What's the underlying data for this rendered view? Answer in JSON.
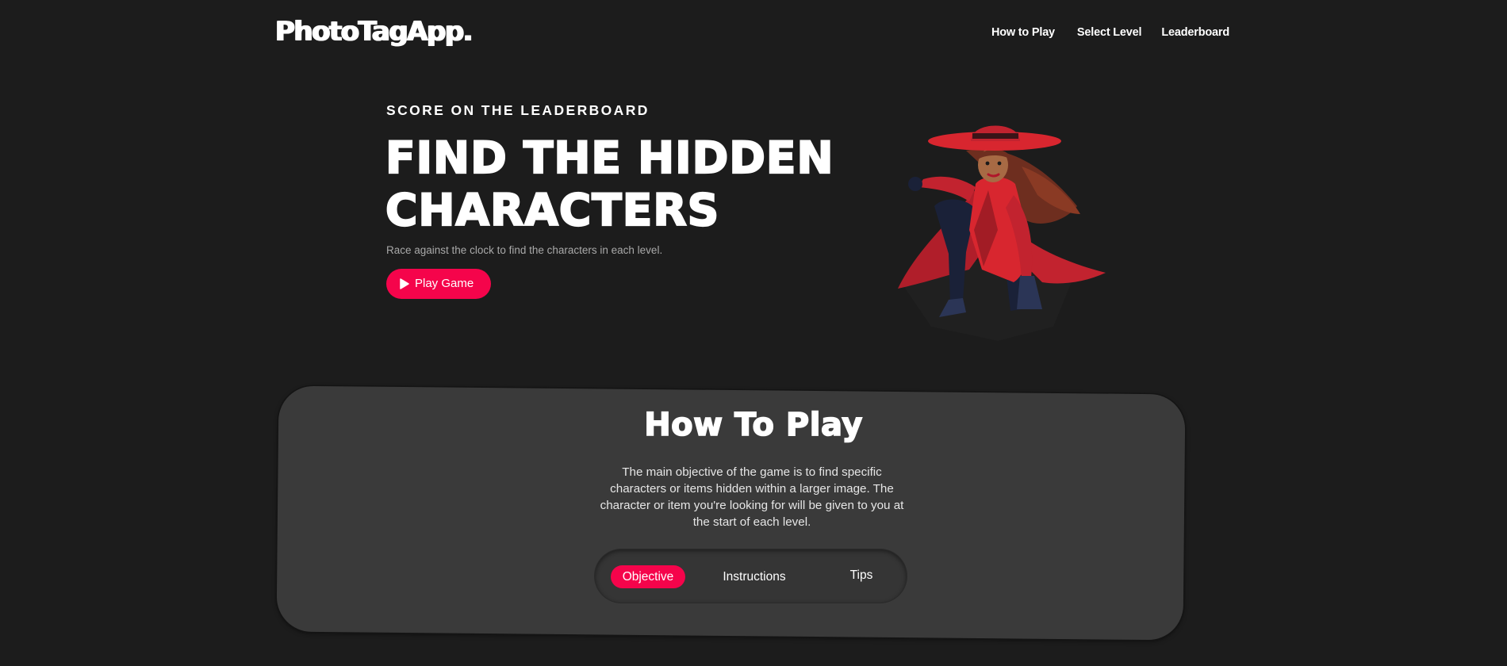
{
  "header": {
    "logo": "PhotoTagApp.",
    "nav": [
      {
        "label": "How to Play"
      },
      {
        "label": "Select Level"
      },
      {
        "label": "Leaderboard"
      }
    ]
  },
  "hero": {
    "eyebrow": "SCORE ON THE LEADERBOARD",
    "title": "FIND THE HIDDEN CHARACTERS",
    "subtitle": "Race against the clock to find the characters in each level.",
    "play_button": "Play Game"
  },
  "how_to_play": {
    "title": "How To Play",
    "description": "The main objective of the game is to find specific characters or items hidden within a larger image. The character or item you're looking for will be given to you at the start of each level.",
    "tabs": [
      {
        "label": "Objective",
        "active": true
      },
      {
        "label": "Instructions",
        "active": false
      },
      {
        "label": "Tips",
        "active": false
      }
    ]
  },
  "colors": {
    "background": "#1c1c1c",
    "card": "#3a3a3a",
    "accent": "#f5044b",
    "text": "#ffffff",
    "muted": "#a9a9a9"
  },
  "icons": {
    "play_button_icon": "play-icon",
    "hero_image": "detective-character-illustration"
  }
}
